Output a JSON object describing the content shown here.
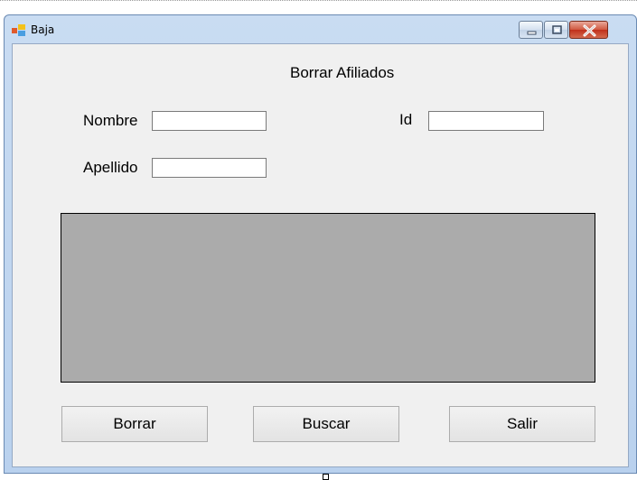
{
  "window": {
    "title": "Baja"
  },
  "form": {
    "heading": "Borrar Afiliados",
    "nombre_label": "Nombre",
    "nombre_value": "",
    "id_label": "Id",
    "id_value": "",
    "apellido_label": "Apellido",
    "apellido_value": ""
  },
  "buttons": {
    "borrar": "Borrar",
    "buscar": "Buscar",
    "salir": "Salir"
  },
  "icons": {
    "app": "form-icon",
    "minimize": "minimize-icon",
    "maximize": "maximize-icon",
    "close": "close-icon"
  },
  "colors": {
    "client_bg": "#f0f0f0",
    "grid_bg": "#ababab",
    "close_red": "#c0301b"
  }
}
